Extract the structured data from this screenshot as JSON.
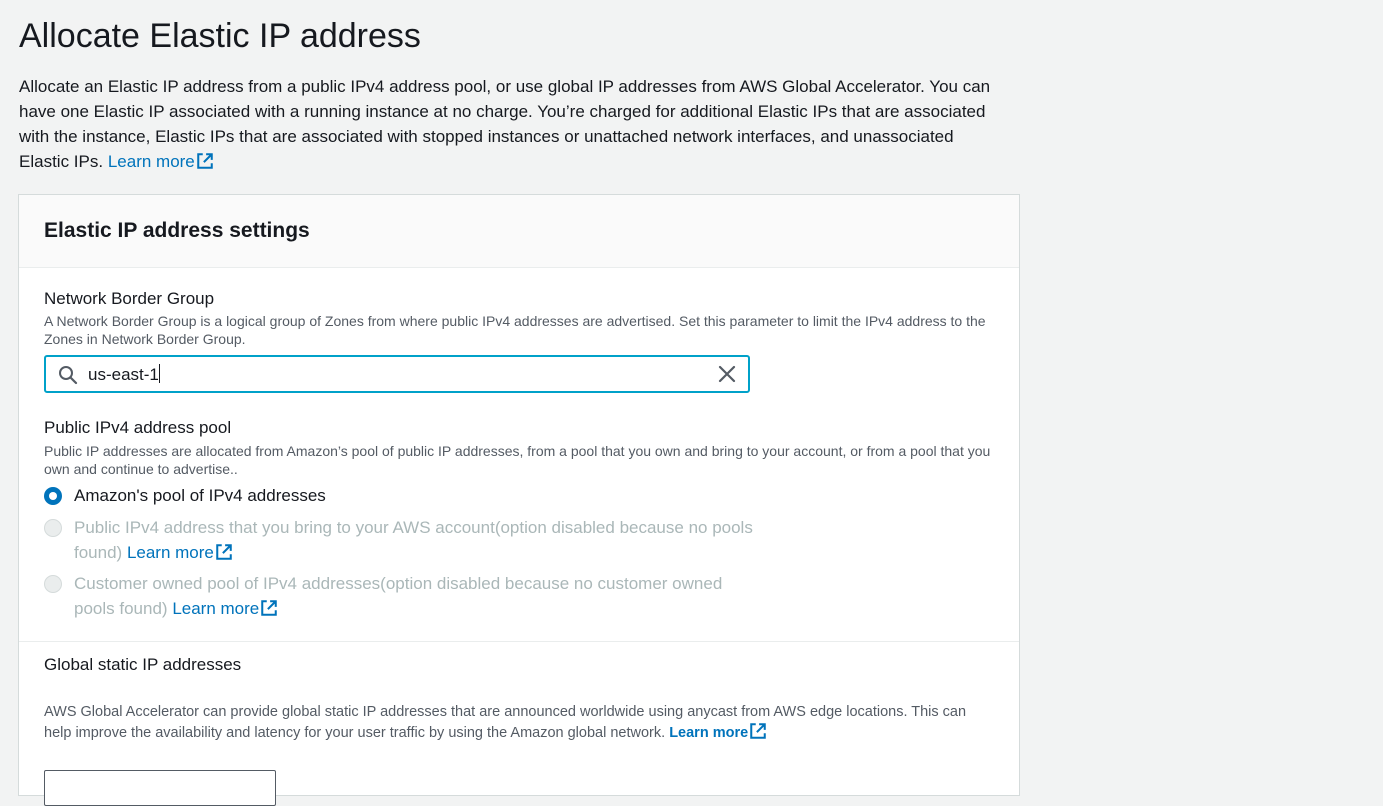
{
  "page": {
    "title": "Allocate Elastic IP address",
    "intro_text": "Allocate an Elastic IP address from a public IPv4 address pool, or use global IP addresses from AWS Global Accelerator. You can have one Elastic IP associated with a running instance at no charge. You’re charged for additional Elastic IPs that are associated with the instance, Elastic IPs that are associated with stopped instances or unattached network interfaces, and unassociated Elastic IPs.",
    "intro_link": "Learn more"
  },
  "settings": {
    "title": "Elastic IP address settings",
    "network_border_group": {
      "label": "Network Border Group",
      "description": "A Network Border Group is a logical group of Zones from where public IPv4 addresses are advertised. Set this parameter to limit the IPv4 address to the Zones in Network Border Group.",
      "value": "us-east-1",
      "search_icon": "search-icon",
      "clear_icon": "close-icon"
    },
    "ipv4_pool": {
      "label": "Public IPv4 address pool",
      "description": "Public IP addresses are allocated from Amazon’s pool of public IP addresses, from a pool that you own and bring to your account, or from a pool that you own and continue to advertise..",
      "options": [
        {
          "label": "Amazon's pool of IPv4 addresses",
          "selected": true,
          "disabled": false,
          "link": ""
        },
        {
          "label": "Public IPv4 address that you bring to your AWS account(option disabled because no pools found)",
          "selected": false,
          "disabled": true,
          "link": "Learn more"
        },
        {
          "label": "Customer owned pool of IPv4 addresses(option disabled because no customer owned pools found)",
          "selected": false,
          "disabled": true,
          "link": "Learn more"
        }
      ]
    },
    "global_static": {
      "label": "Global static IP addresses",
      "description": "AWS Global Accelerator can provide global static IP addresses that are announced worldwide using anycast from AWS edge locations. This can help improve the availability and latency for your user traffic by using the Amazon global network.",
      "link": "Learn more"
    }
  },
  "colors": {
    "link": "#0073bb",
    "focus_border": "#00a1c9",
    "radio_selected": "#0073bb",
    "disabled_text": "#aab7b8"
  }
}
